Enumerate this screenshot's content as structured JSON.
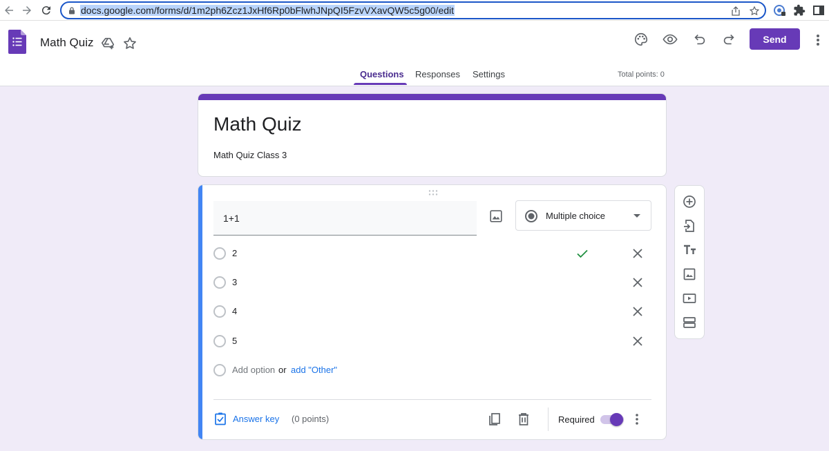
{
  "browser": {
    "url": "docs.google.com/forms/d/1m2ph6Zcz1JxHf6Rp0bFlwhJNpQI5FzvVXavQW5c5g00/edit",
    "nav_icons": [
      "back-arrow-icon",
      "forward-arrow-icon",
      "reload-icon"
    ],
    "omnibox_icons": [
      "share-icon",
      "bookmark-star-icon"
    ],
    "extension_icons": [
      "profile-extension-icon",
      "extensions-puzzle-icon",
      "side-panel-icon"
    ]
  },
  "header": {
    "app_logo": "google-forms-logo",
    "doc_title": "Math Quiz",
    "title_icons": [
      "move-to-drive-icon",
      "star-icon"
    ],
    "toolbar_icons": [
      "palette-icon",
      "preview-eye-icon",
      "undo-icon",
      "redo-icon"
    ],
    "send_label": "Send",
    "more_icon": "more-vert-icon"
  },
  "tabs": [
    {
      "label": "Questions",
      "active": true
    },
    {
      "label": "Responses",
      "active": false
    },
    {
      "label": "Settings",
      "active": false
    }
  ],
  "total_points": "Total points: 0",
  "colors": {
    "brand": "#673ab7",
    "background": "#f0ebf8",
    "question_accent": "#4285f4",
    "correct_check": "#1e8e3e",
    "link": "#1a73e8"
  },
  "form": {
    "title": "Math Quiz",
    "description": "Math Quiz Class 3"
  },
  "question": {
    "text": "1+1",
    "type": "Multiple choice",
    "options": [
      {
        "label": "2",
        "correct": true
      },
      {
        "label": "3",
        "correct": false
      },
      {
        "label": "4",
        "correct": false
      },
      {
        "label": "5",
        "correct": false
      }
    ],
    "add_option_label": "Add option",
    "or_label": "or",
    "add_other_label": "add \"Other\"",
    "answer_key_label": "Answer key",
    "points_label": "(0 points)",
    "required_label": "Required",
    "required": true
  },
  "side_toolbar": [
    {
      "name": "add-question",
      "icon": "add-circle-icon"
    },
    {
      "name": "import-questions",
      "icon": "import-icon"
    },
    {
      "name": "add-title-description",
      "icon": "title-tt-icon"
    },
    {
      "name": "add-image",
      "icon": "image-icon"
    },
    {
      "name": "add-video",
      "icon": "video-icon"
    },
    {
      "name": "add-section",
      "icon": "section-icon"
    }
  ]
}
